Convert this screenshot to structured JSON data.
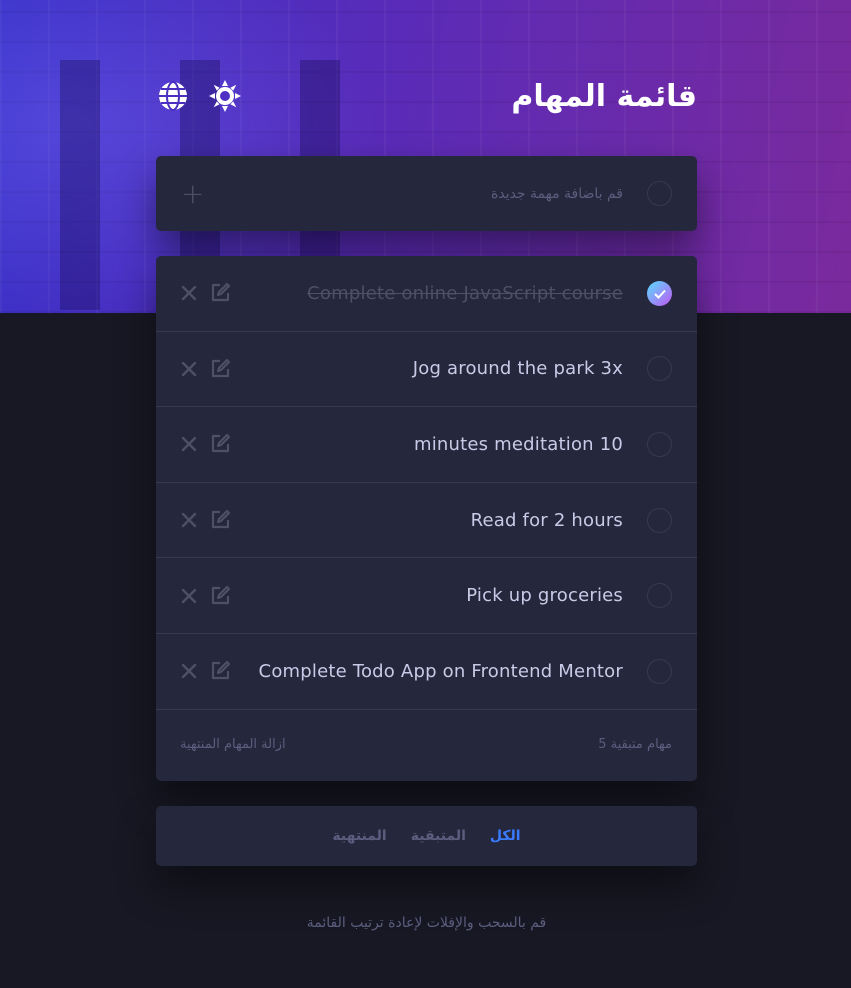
{
  "header": {
    "title": "قائمة المهام",
    "language_icon": "globe-icon",
    "theme_icon": "sun-icon"
  },
  "new_task": {
    "placeholder": "قم باضافة مهمة جديدة",
    "add_icon": "plus-icon"
  },
  "tasks": [
    {
      "text": "Complete online JavaScript course",
      "completed": true
    },
    {
      "text": "Jog around the park 3x",
      "completed": false
    },
    {
      "text": "minutes meditation 10",
      "completed": false
    },
    {
      "text": "Read for 2 hours",
      "completed": false
    },
    {
      "text": "Pick up groceries",
      "completed": false
    },
    {
      "text": "Complete Todo App on Frontend Mentor",
      "completed": false
    }
  ],
  "footer": {
    "items_left": "5 مهام متبقية",
    "clear_completed": "ازالة المهام المنتهية"
  },
  "filters": {
    "all": "الكل",
    "active": "المتبقية",
    "completed": "المنتهية",
    "selected": "all"
  },
  "hint": "قم بالسحب والإفلات لإعادة ترتيب القائمة",
  "colors": {
    "accent": "#3a7bfd",
    "card": "#25273c",
    "background": "#181824",
    "check_gradient_start": "#57ddff",
    "check_gradient_end": "#c058f3"
  }
}
